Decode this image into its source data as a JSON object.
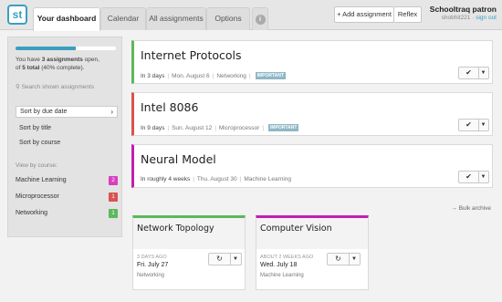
{
  "header": {
    "logo": "st",
    "tabs": [
      {
        "label": "Your dashboard",
        "active": true
      },
      {
        "label": "Calendar",
        "active": false
      },
      {
        "label": "All assignments",
        "active": false
      },
      {
        "label": "Options",
        "active": false
      }
    ],
    "info_label": "i",
    "add_assignment": "+ Add assignment",
    "reflex": "Reflex",
    "app_name": "Schooltraq patron",
    "username": "shobhit221",
    "signout": "sign out"
  },
  "sidebar": {
    "progress_fraction": 0.6,
    "summary_pre": "You have ",
    "summary_open": "3 assignments",
    "summary_mid": " open,",
    "summary_line2_pre": "of ",
    "summary_total": "5 total",
    "summary_line2_post": " (40% complete).",
    "search_placeholder": "Search shown assignments",
    "sort_options": [
      "Sort by due date",
      "Sort by title",
      "Sort by course"
    ],
    "view_by_course_label": "View by course:",
    "courses": [
      {
        "name": "Machine Learning",
        "count": "2",
        "color": "#d63fbf"
      },
      {
        "name": "Microprocessor",
        "count": "1",
        "color": "#d9534f"
      },
      {
        "name": "Networking",
        "count": "1",
        "color": "#5cb85c"
      }
    ]
  },
  "assignments": [
    {
      "title": "Internet Protocols",
      "due_in": "In 3 days",
      "date": "Mon. August 6",
      "course": "Networking",
      "important": "IMPORTANT",
      "color": "#5cb85c"
    },
    {
      "title": "Intel 8086",
      "due_in": "In 9 days",
      "date": "Sun. August 12",
      "course": "Microprocessor",
      "important": "IMPORTANT",
      "color": "#d9534f"
    },
    {
      "title": "Neural Model",
      "due_in": "In roughly 4 weeks",
      "date": "Thu. August 30",
      "course": "Machine Learning",
      "important": "",
      "color": "#c21fb0"
    }
  ],
  "bulk_archive": "Bulk archive",
  "completed": [
    {
      "title": "Network Topology",
      "ago": "3 DAYS AGO",
      "date": "Fri. July 27",
      "course": "Networking",
      "color": "#5cb85c"
    },
    {
      "title": "Computer Vision",
      "ago": "ABOUT 2 WEEKS AGO",
      "date": "Wed. July 18",
      "course": "Machine Learning",
      "color": "#c21fb0"
    }
  ],
  "icons": {
    "check": "✔",
    "dropdown": "▼",
    "refresh": "↻",
    "chevron": "›",
    "arrow": "→"
  }
}
